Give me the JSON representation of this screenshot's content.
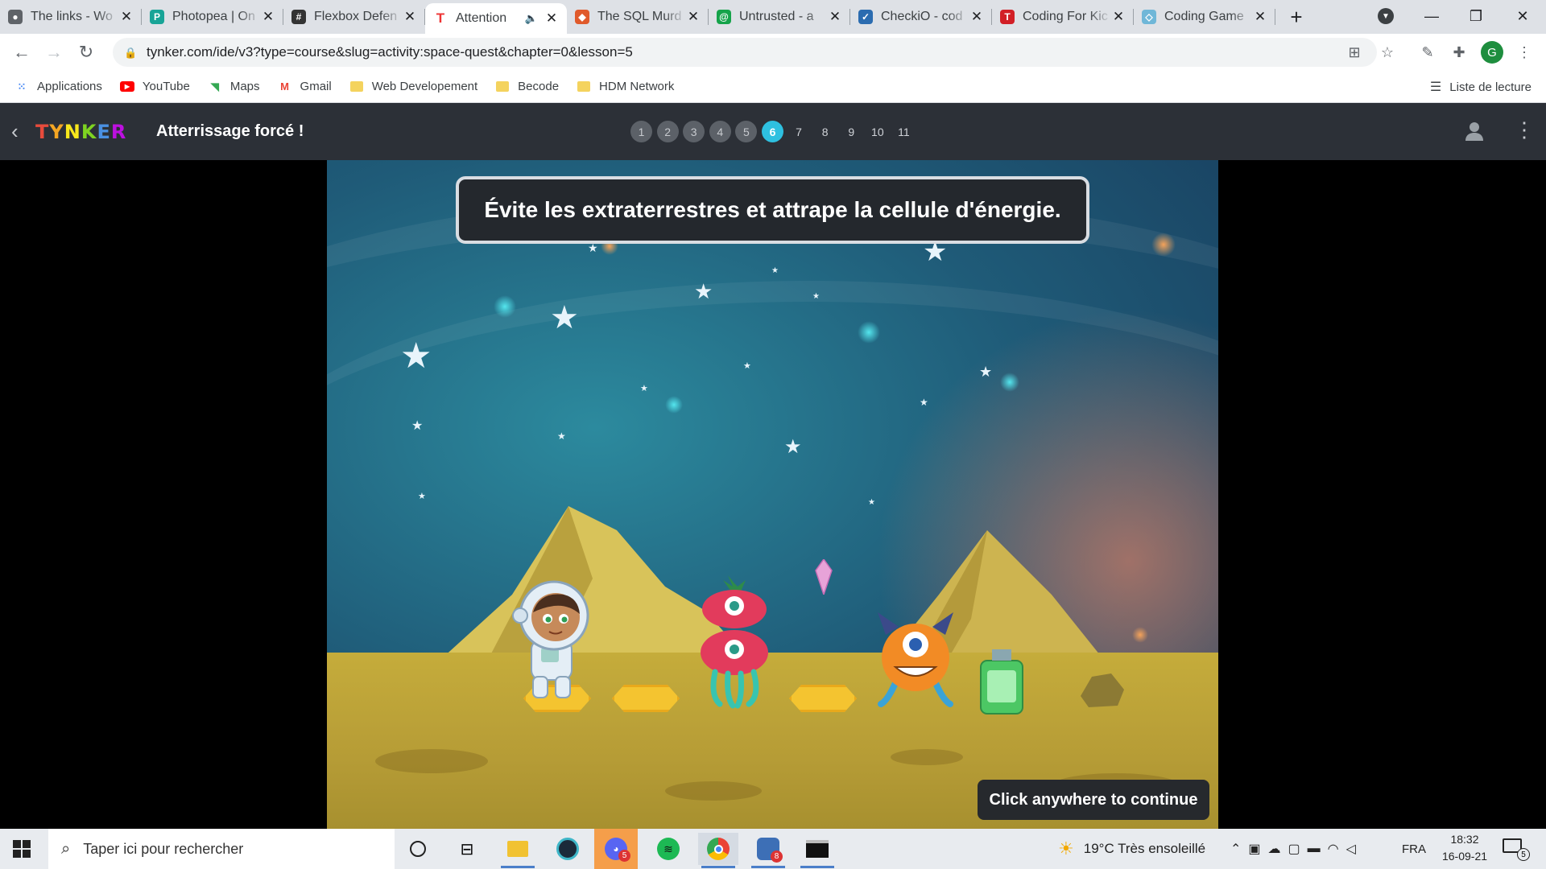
{
  "browser": {
    "tabs": [
      {
        "title": "The links - Wo",
        "fav": "#5f6368",
        "glyph": "●"
      },
      {
        "title": "Photopea | On",
        "fav": "#18a497",
        "glyph": "P"
      },
      {
        "title": "Flexbox Defen",
        "fav": "#333",
        "glyph": "#"
      },
      {
        "title": "Attention",
        "fav": "#e33",
        "glyph": "T",
        "active": true
      },
      {
        "title": "The SQL Murd",
        "fav": "#e05a2b",
        "glyph": "◆"
      },
      {
        "title": "Untrusted - a",
        "fav": "#15a34a",
        "glyph": "@"
      },
      {
        "title": "CheckiO - cod",
        "fav": "#2b6cb0",
        "glyph": "✓"
      },
      {
        "title": "Coding For Kic",
        "fav": "#d21f26",
        "glyph": "T"
      },
      {
        "title": "Coding Game",
        "fav": "#6fb7d8",
        "glyph": "◇"
      }
    ],
    "url": "tynker.com/ide/v3?type=course&slug=activity:space-quest&chapter=0&lesson=5",
    "avatar_letter": "G",
    "bookmarks": [
      {
        "label": "Applications",
        "icon": "apps-icon"
      },
      {
        "label": "YouTube",
        "icon": "youtube-icon"
      },
      {
        "label": "Maps",
        "icon": "maps-icon"
      },
      {
        "label": "Gmail",
        "icon": "gmail-icon"
      },
      {
        "label": "Web Developement",
        "icon": "folder-icon"
      },
      {
        "label": "Becode",
        "icon": "folder-icon"
      },
      {
        "label": "HDM Network",
        "icon": "folder-icon"
      }
    ],
    "reading_list": "Liste de lecture"
  },
  "tynker": {
    "logo": "TYNKER",
    "lesson_title": "Atterrissage forcé !",
    "steps": [
      "1",
      "2",
      "3",
      "4",
      "5",
      "6",
      "7",
      "8",
      "9",
      "10",
      "11"
    ],
    "current_step": 6,
    "colors": {
      "accent": "#2ec0e0",
      "bar": "#2c3037"
    }
  },
  "game": {
    "instruction": "Évite les extraterrestres et attrape la cellule d'énergie.",
    "continue_label": "Click anywhere to continue"
  },
  "taskbar": {
    "search_placeholder": "Taper ici pour rechercher",
    "weather": "19°C  Très ensoleillé",
    "language": "FRA",
    "time": "18:32",
    "date": "16-09-21",
    "notification_count": "5",
    "discord_badge": "5",
    "app_badge": "8"
  }
}
